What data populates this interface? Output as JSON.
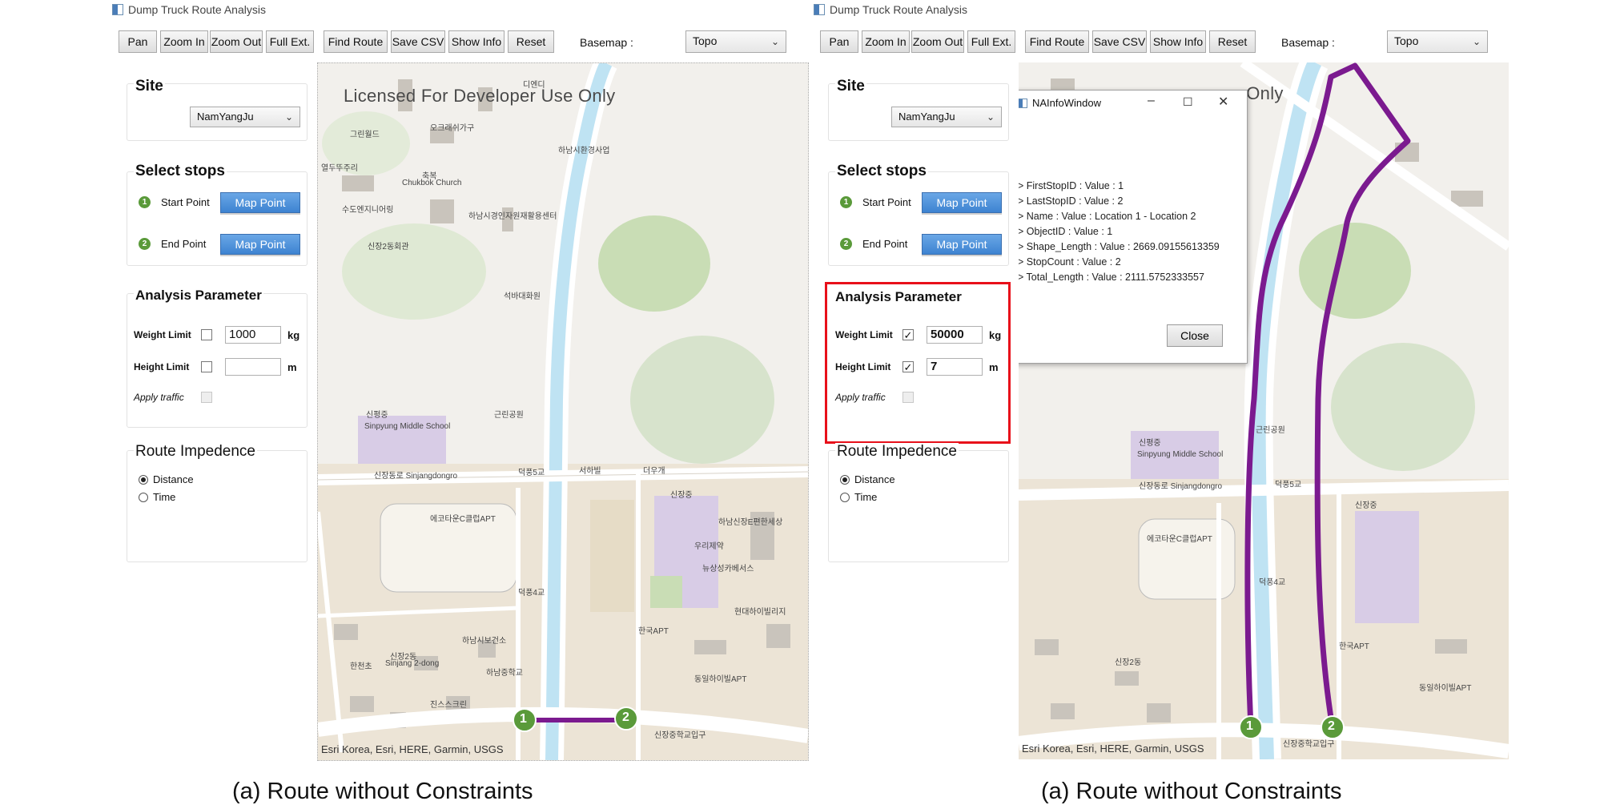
{
  "panels": [
    {
      "window_title": "Dump Truck Route Analysis",
      "toolbar": {
        "pan": "Pan",
        "zoom_in": "Zoom In",
        "zoom_out": "Zoom Out",
        "full_ext": "Full Ext.",
        "find_route": "Find Route",
        "save_csv": "Save CSV",
        "show_info": "Show Info",
        "reset": "Reset",
        "basemap_label": "Basemap :",
        "basemap_value": "Topo"
      },
      "site": {
        "title": "Site",
        "value": "NamYangJu"
      },
      "stops": {
        "title": "Select stops",
        "start_num": "1",
        "start_label": "Start Point",
        "start_button": "Map Point",
        "end_num": "2",
        "end_label": "End Point",
        "end_button": "Map Point"
      },
      "analysis": {
        "title": "Analysis Parameter",
        "weight_label": "Weight Limit",
        "weight_checked": false,
        "weight_value": "1000",
        "weight_unit": "kg",
        "height_label": "Height Limit",
        "height_checked": false,
        "height_value": "",
        "height_unit": "m",
        "traffic_label": "Apply traffic"
      },
      "impedance": {
        "title": "Route Impedence",
        "distance": "Distance",
        "time": "Time",
        "selected": "distance"
      },
      "map": {
        "watermark": "Licensed For Developer Use Only",
        "attribution": "Esri Korea, Esri, HERE, Garmin, USGS",
        "marker_start": "1",
        "marker_end": "2"
      },
      "caption": "(a) Route without Constraints"
    },
    {
      "window_title": "Dump Truck Route Analysis",
      "toolbar": {
        "pan": "Pan",
        "zoom_in": "Zoom In",
        "zoom_out": "Zoom Out",
        "full_ext": "Full Ext.",
        "find_route": "Find Route",
        "save_csv": "Save CSV",
        "show_info": "Show Info",
        "reset": "Reset",
        "basemap_label": "Basemap :",
        "basemap_value": "Topo"
      },
      "site": {
        "title": "Site",
        "value": "NamYangJu"
      },
      "stops": {
        "title": "Select stops",
        "start_num": "1",
        "start_label": "Start Point",
        "start_button": "Map Point",
        "end_num": "2",
        "end_label": "End Point",
        "end_button": "Map Point"
      },
      "analysis": {
        "title": "Analysis Parameter",
        "weight_label": "Weight Limit",
        "weight_checked": true,
        "weight_value": "50000",
        "weight_unit": "kg",
        "height_label": "Height Limit",
        "height_checked": true,
        "height_value": "7",
        "height_unit": "m",
        "traffic_label": "Apply traffic"
      },
      "impedance": {
        "title": "Route Impedence",
        "distance": "Distance",
        "time": "Time",
        "selected": "distance"
      },
      "map": {
        "watermark": "se Only",
        "attribution": "Esri Korea, Esri, HERE, Garmin, USGS",
        "marker_start": "1",
        "marker_end": "2"
      },
      "info_window": {
        "title": "NAInfoWindow",
        "lines": [
          "> FirstStopID : Value : 1",
          "> LastStopID : Value : 2",
          "> Name : Value : Location 1 - Location 2",
          "> ObjectID : Value : 1",
          "> Shape_Length : Value : 2669.09155613359",
          "> StopCount : Value : 2",
          "> Total_Length : Value : 2111.5752333557"
        ],
        "close": "Close"
      },
      "caption": "(a) Route without Constraints"
    }
  ],
  "map_labels": [
    "디엔디",
    "그린월드",
    "오크래쉬가구",
    "하남시환경사업",
    "열두뚜주리",
    "축복",
    "Chukbok Church",
    "수도엔지니어링",
    "하남시경인자원재활용센터",
    "신장2동회관",
    "석바대화원",
    "신평중",
    "Sinpyung Middle School",
    "신장동로 Sinjangdongro",
    "덕풍5교",
    "서하빌",
    "더우개",
    "신장중",
    "에코타운C클럽APT",
    "하남신장E편한세상",
    "한국APT",
    "동일하이빌APT",
    "하남시보건소",
    "현대하이빌리지",
    "신장2동",
    "Sinjang 2-dong",
    "한천초",
    "하남중학교",
    "신장중학교입구",
    "진스스크린",
    "덕풍4교",
    "근린공원",
    "뉴상성카베서스",
    "우리제약"
  ],
  "colors": {
    "route": "#7b1a8f",
    "marker": "#5a9a3a",
    "map_button": "#3d83d1",
    "highlight": "#e8101a",
    "river": "#bfe3f3",
    "park": "#c9ddb5",
    "school": "#d8cce6"
  }
}
